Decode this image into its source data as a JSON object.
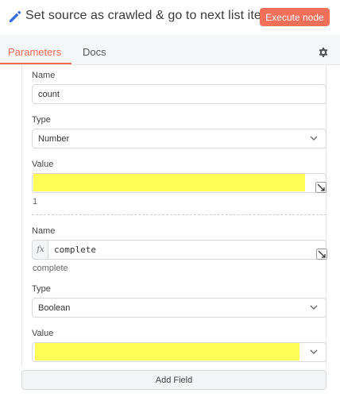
{
  "header": {
    "title": "Set source as crawled & go to next list item",
    "execute_label": "Execute node",
    "edit_icon": "pencil-icon",
    "accent": "#f2705a"
  },
  "tabs": [
    {
      "label": "Parameters",
      "active": true
    },
    {
      "label": "Docs",
      "active": false
    }
  ],
  "settings_icon": "gear-icon",
  "fields": [
    {
      "name_label": "Name",
      "name_value": "count",
      "type_label": "Type",
      "type_value": "Number",
      "value_label": "Value",
      "value_hint": "1"
    },
    {
      "name_label": "Name",
      "name_value": "complete",
      "name_hint": "complete",
      "type_label": "Type",
      "type_value": "Boolean",
      "value_label": "Value",
      "fx_label": "fx"
    }
  ],
  "add_field_label": "Add Field",
  "highlight_color": "#ffff57"
}
